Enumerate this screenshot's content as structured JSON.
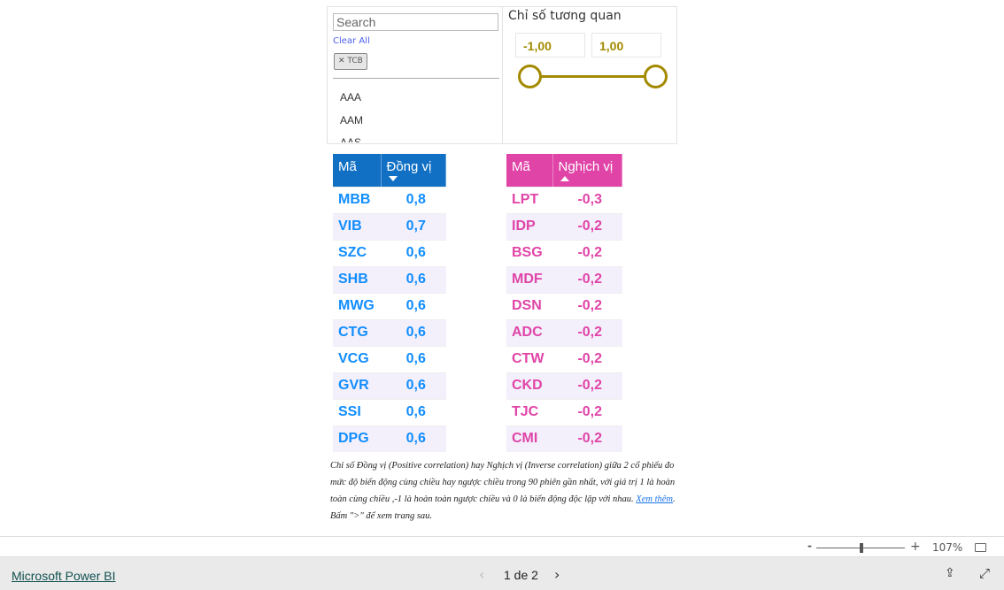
{
  "slicer": {
    "search_placeholder": "Search",
    "clear_all": "Clear All",
    "selected_chip": "TCB",
    "items": [
      "AAA",
      "AAM",
      "AAS"
    ]
  },
  "range": {
    "title": "Chỉ số tương quan",
    "min": "-1,00",
    "max": "1,00",
    "color": "#a38a00"
  },
  "positive": {
    "headers": [
      "Mã",
      "Đồng vị"
    ],
    "sort": "descending",
    "color": "#118dff",
    "header_bg": "#1170c4",
    "rows": [
      [
        "MBB",
        "0,8"
      ],
      [
        "VIB",
        "0,7"
      ],
      [
        "SZC",
        "0,6"
      ],
      [
        "SHB",
        "0,6"
      ],
      [
        "MWG",
        "0,6"
      ],
      [
        "CTG",
        "0,6"
      ],
      [
        "VCG",
        "0,6"
      ],
      [
        "GVR",
        "0,6"
      ],
      [
        "SSI",
        "0,6"
      ],
      [
        "DPG",
        "0,6"
      ]
    ]
  },
  "negative": {
    "headers": [
      "Mã",
      "Nghịch vị"
    ],
    "sort": "ascending",
    "color": "#e044a7",
    "header_bg": "#e044a7",
    "rows": [
      [
        "LPT",
        "-0,3"
      ],
      [
        "IDP",
        "-0,2"
      ],
      [
        "BSG",
        "-0,2"
      ],
      [
        "MDF",
        "-0,2"
      ],
      [
        "DSN",
        "-0,2"
      ],
      [
        "ADC",
        "-0,2"
      ],
      [
        "CTW",
        "-0,2"
      ],
      [
        "CKD",
        "-0,2"
      ],
      [
        "TJC",
        "-0,2"
      ],
      [
        "CMI",
        "-0,2"
      ]
    ]
  },
  "note": {
    "text1": "Chỉ số Đồng vị (Positive correlation) hay Nghịch vị (Inverse correlation) giữa 2 cổ phiếu đo mức độ biến động cùng chiều hay ngược chiều trong 90 phiên gần nhất, với giá trị 1 là hoàn toàn cùng chiều ,-1 là hoàn toàn ngược chiều và 0 là biến động độc lập với nhau. ",
    "link": "Xem thêm",
    "text2": ". Bấm \">\" để xem trang sau."
  },
  "zoom": {
    "minus": "-",
    "plus": "+",
    "level": "107%",
    "value_percent": 107
  },
  "footer": {
    "brand": "Microsoft Power BI",
    "page": "1 de 2"
  }
}
